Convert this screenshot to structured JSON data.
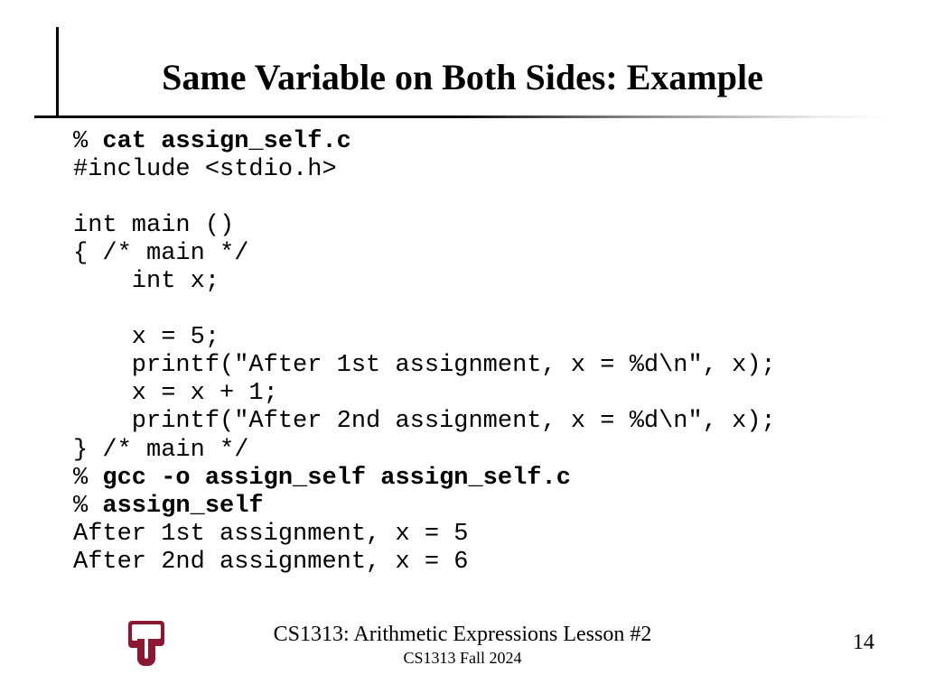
{
  "title": "Same Variable on Both Sides: Example",
  "code": {
    "l01a": "% ",
    "l01b": "cat assign_self.c",
    "l02": "#include <stdio.h>",
    "l03": "",
    "l04": "int main ()",
    "l05": "{ /* main */",
    "l06": "    int x;",
    "l07": "",
    "l08": "    x = 5;",
    "l09": "    printf(\"After 1st assignment, x = %d\\n\", x);",
    "l10": "    x = x + 1;",
    "l11": "    printf(\"After 2nd assignment, x = %d\\n\", x);",
    "l12": "} /* main */",
    "l13a": "% ",
    "l13b": "gcc -o assign_self assign_self.c",
    "l14a": "% ",
    "l14b": "assign_self",
    "l15": "After 1st assignment, x = 5",
    "l16": "After 2nd assignment, x = 6"
  },
  "footer": {
    "line1": "CS1313: Arithmetic Expressions Lesson #2",
    "line2": "CS1313 Fall 2024"
  },
  "page_number": "14",
  "logo_color": "#8a1830"
}
